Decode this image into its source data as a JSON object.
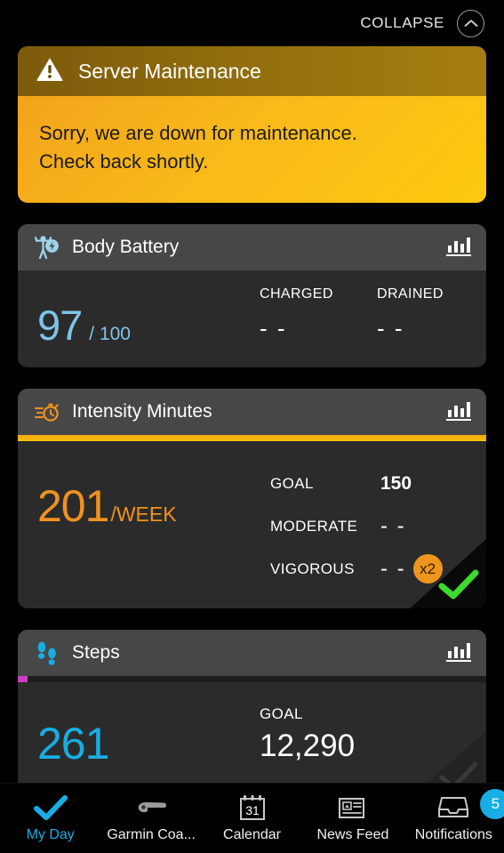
{
  "topbar": {
    "collapse_label": "COLLAPSE",
    "chevron_icon": "chevron-up-icon"
  },
  "maintenance": {
    "icon": "warning-triangle-icon",
    "title": "Server Maintenance",
    "message_line1": "Sorry, we are down for maintenance.",
    "message_line2": "Check back shortly.",
    "header_color": "#94710d",
    "body_color": "#f9b91a"
  },
  "body_battery": {
    "icon": "body-battery-icon",
    "title": "Body Battery",
    "chart_icon": "bar-chart-icon",
    "value": "97",
    "value_suffix": "/ 100",
    "accent_color": "#7fc4e8",
    "columns": [
      {
        "label": "CHARGED",
        "value": "- -"
      },
      {
        "label": "DRAINED",
        "value": "- -"
      }
    ]
  },
  "intensity_minutes": {
    "icon": "stopwatch-icon",
    "title": "Intensity Minutes",
    "chart_icon": "bar-chart-icon",
    "value": "201",
    "unit": "/WEEK",
    "accent_color": "#f0921e",
    "progress_percent": 100,
    "progress_color": "#f5b60d",
    "stats": [
      {
        "label": "GOAL",
        "value": "150",
        "badge": null
      },
      {
        "label": "MODERATE",
        "value": "- -",
        "badge": null
      },
      {
        "label": "VIGOROUS",
        "value": "- -",
        "badge": "x2"
      }
    ],
    "goal_met": true,
    "check_color": "#3ddb2e"
  },
  "steps": {
    "icon": "footprints-icon",
    "title": "Steps",
    "chart_icon": "bar-chart-icon",
    "value": "261",
    "accent_color": "#18aee5",
    "progress_percent": 2,
    "progress_color": "#cc3fc4",
    "goal_label": "GOAL",
    "goal_value": "12,290",
    "goal_met": false,
    "check_color": "#3a3a3a"
  },
  "nav": {
    "items": [
      {
        "label": "My Day",
        "icon": "checkmark-icon",
        "active": true,
        "badge": null
      },
      {
        "label": "Garmin Coa...",
        "icon": "whistle-icon",
        "active": false,
        "badge": null
      },
      {
        "label": "Calendar",
        "icon": "calendar-icon",
        "active": false,
        "badge": null,
        "day": "31"
      },
      {
        "label": "News Feed",
        "icon": "newspaper-icon",
        "active": false,
        "badge": null
      },
      {
        "label": "Notifications",
        "icon": "inbox-icon",
        "active": false,
        "badge": "5"
      }
    ],
    "badge_color": "#18aee5"
  }
}
